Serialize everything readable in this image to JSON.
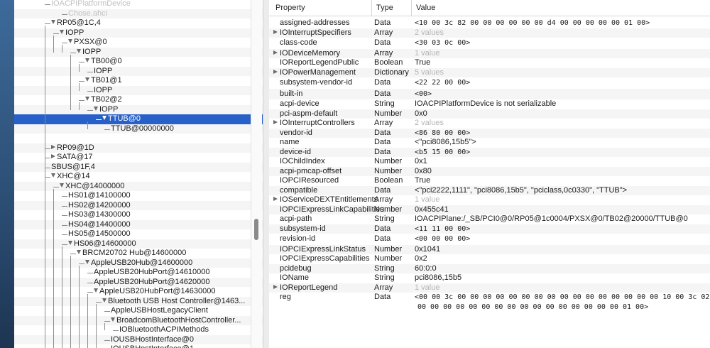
{
  "tree": {
    "rows": [
      {
        "label": "IOACPIPlatformDevice",
        "depth": 4,
        "tri": "",
        "faint": true
      },
      {
        "label": "Chose.ahci",
        "depth": 6,
        "tri": "",
        "faint": true
      },
      {
        "label": "RP05@1C,4",
        "depth": 4,
        "tri": "down"
      },
      {
        "label": "IOPP",
        "depth": 5,
        "tri": "down"
      },
      {
        "label": "PXSX@0",
        "depth": 6,
        "tri": "down"
      },
      {
        "label": "IOPP",
        "depth": 7,
        "tri": "down"
      },
      {
        "label": "TB00@0",
        "depth": 8,
        "tri": "down"
      },
      {
        "label": "IOPP",
        "depth": 9,
        "tri": ""
      },
      {
        "label": "TB01@1",
        "depth": 8,
        "tri": "down"
      },
      {
        "label": "IOPP",
        "depth": 9,
        "tri": ""
      },
      {
        "label": "TB02@2",
        "depth": 8,
        "tri": "down"
      },
      {
        "label": "IOPP",
        "depth": 9,
        "tri": "down"
      },
      {
        "label": "TTUB@0",
        "depth": 10,
        "tri": "down",
        "selected": true
      },
      {
        "label": "TTUB@00000000",
        "depth": 11,
        "tri": ""
      },
      {
        "label": "",
        "depth": 0,
        "tri": ""
      },
      {
        "label": "RP09@1D",
        "depth": 4,
        "tri": "right"
      },
      {
        "label": "SATA@17",
        "depth": 4,
        "tri": "right"
      },
      {
        "label": "SBUS@1F,4",
        "depth": 4,
        "tri": ""
      },
      {
        "label": "XHC@14",
        "depth": 4,
        "tri": "down"
      },
      {
        "label": "XHC@14000000",
        "depth": 5,
        "tri": "down"
      },
      {
        "label": "HS01@14100000",
        "depth": 6,
        "tri": ""
      },
      {
        "label": "HS02@14200000",
        "depth": 6,
        "tri": ""
      },
      {
        "label": "HS03@14300000",
        "depth": 6,
        "tri": ""
      },
      {
        "label": "HS04@14400000",
        "depth": 6,
        "tri": ""
      },
      {
        "label": "HS05@14500000",
        "depth": 6,
        "tri": ""
      },
      {
        "label": "HS06@14600000",
        "depth": 6,
        "tri": "down"
      },
      {
        "label": "BRCM20702 Hub@14600000",
        "depth": 7,
        "tri": "down"
      },
      {
        "label": "AppleUSB20Hub@14600000",
        "depth": 8,
        "tri": "down"
      },
      {
        "label": "AppleUSB20HubPort@14610000",
        "depth": 9,
        "tri": ""
      },
      {
        "label": "AppleUSB20HubPort@14620000",
        "depth": 9,
        "tri": ""
      },
      {
        "label": "AppleUSB20HubPort@14630000",
        "depth": 9,
        "tri": "down"
      },
      {
        "label": "Bluetooth USB Host Controller@1463...",
        "depth": 10,
        "tri": "down"
      },
      {
        "label": "AppleUSBHostLegacyClient",
        "depth": 11,
        "tri": ""
      },
      {
        "label": "BroadcomBluetoothHostController...",
        "depth": 11,
        "tri": "down"
      },
      {
        "label": "IOBluetoothACPIMethods",
        "depth": 12,
        "tri": ""
      },
      {
        "label": "IOUSBHostInterface@0",
        "depth": 11,
        "tri": ""
      },
      {
        "label": "IOUSBHostInterface@1",
        "depth": 11,
        "tri": ""
      }
    ]
  },
  "props": {
    "headers": {
      "property": "Property",
      "type": "Type",
      "value": "Value"
    },
    "rows": [
      {
        "name": "assigned-addresses",
        "type": "Data",
        "value": "<10 00 3c 82 00 00 00 00 00 00 d4 00 00 00 00 00 01 00>",
        "mono": true,
        "expand": false
      },
      {
        "name": "IOInterruptSpecifiers",
        "type": "Array",
        "value": "2 values",
        "grey": true,
        "expand": true
      },
      {
        "name": "class-code",
        "type": "Data",
        "value": "<30 03 0c 00>",
        "mono": true,
        "expand": false
      },
      {
        "name": "IODeviceMemory",
        "type": "Array",
        "value": "1 value",
        "grey": true,
        "expand": true
      },
      {
        "name": "IOReportLegendPublic",
        "type": "Boolean",
        "value": "True",
        "expand": false
      },
      {
        "name": "IOPowerManagement",
        "type": "Dictionary",
        "value": "5 values",
        "grey": true,
        "expand": true
      },
      {
        "name": "subsystem-vendor-id",
        "type": "Data",
        "value": "<22 22 00 00>",
        "mono": true,
        "expand": false
      },
      {
        "name": "built-in",
        "type": "Data",
        "value": "<00>",
        "mono": true,
        "expand": false
      },
      {
        "name": "acpi-device",
        "type": "String",
        "value": "IOACPIPlatformDevice is not serializable",
        "expand": false
      },
      {
        "name": "pci-aspm-default",
        "type": "Number",
        "value": "0x0",
        "expand": false
      },
      {
        "name": "IOInterruptControllers",
        "type": "Array",
        "value": "2 values",
        "grey": true,
        "expand": true
      },
      {
        "name": "vendor-id",
        "type": "Data",
        "value": "<86 80 00 00>",
        "mono": true,
        "expand": false
      },
      {
        "name": "name",
        "type": "Data",
        "value": "<\"pci8086,15b5\">",
        "expand": false
      },
      {
        "name": "device-id",
        "type": "Data",
        "value": "<b5 15 00 00>",
        "mono": true,
        "expand": false
      },
      {
        "name": "IOChildIndex",
        "type": "Number",
        "value": "0x1",
        "expand": false
      },
      {
        "name": "acpi-pmcap-offset",
        "type": "Number",
        "value": "0x80",
        "expand": false
      },
      {
        "name": "IOPCIResourced",
        "type": "Boolean",
        "value": "True",
        "expand": false
      },
      {
        "name": "compatible",
        "type": "Data",
        "value": "<\"pci2222,1111\", \"pci8086,15b5\", \"pciclass,0c0330\", \"TTUB\">",
        "expand": false
      },
      {
        "name": "IOServiceDEXTEntitlements",
        "type": "Array",
        "value": "1 value",
        "grey": true,
        "expand": true
      },
      {
        "name": "IOPCIExpressLinkCapabilities",
        "type": "Number",
        "value": "0x455c41",
        "expand": false
      },
      {
        "name": "acpi-path",
        "type": "String",
        "value": "IOACPIPlane:/_SB/PCI0@0/RP05@1c0004/PXSX@0/TB02@20000/TTUB@0",
        "expand": false
      },
      {
        "name": "subsystem-id",
        "type": "Data",
        "value": "<11 11 00 00>",
        "mono": true,
        "expand": false
      },
      {
        "name": "revision-id",
        "type": "Data",
        "value": "<00 00 00 00>",
        "mono": true,
        "expand": false
      },
      {
        "name": "IOPCIExpressLinkStatus",
        "type": "Number",
        "value": "0x1041",
        "expand": false
      },
      {
        "name": "IOPCIExpressCapabilities",
        "type": "Number",
        "value": "0x2",
        "expand": false
      },
      {
        "name": "pcidebug",
        "type": "String",
        "value": "60:0:0",
        "expand": false
      },
      {
        "name": "IOName",
        "type": "String",
        "value": "pci8086,15b5",
        "expand": false
      },
      {
        "name": "IOReportLegend",
        "type": "Array",
        "value": "1 value",
        "grey": true,
        "expand": true
      },
      {
        "name": "reg",
        "type": "Data",
        "value": "<00 00 3c 00 00 00 00 00 00 00 00 00 00 00 00 00 00 00 00 10 00 3c 02",
        "value2": "00 00 00 00 00 00 00 00 00 00 00 00 00 00 00 00 01 00>",
        "mono": true,
        "expand": false
      }
    ]
  }
}
